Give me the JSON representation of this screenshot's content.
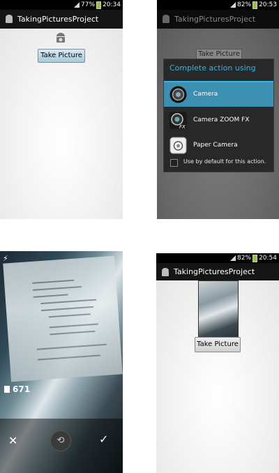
{
  "panel1": {
    "time": "20:34",
    "battery": "77%",
    "app_title": "TakingPicturesProject",
    "button_label": "Take Picture"
  },
  "panel2": {
    "time": "20:53",
    "battery": "82%",
    "app_title": "TakingPicturesProject",
    "button_label": "Take Picture",
    "dialog_title": "Complete action using",
    "options": [
      {
        "label": "Camera",
        "selected": true
      },
      {
        "label": "Camera ZOOM FX",
        "selected": false
      },
      {
        "label": "Paper Camera",
        "selected": false
      }
    ],
    "default_label": "Use by default for this action."
  },
  "panel3": {
    "remaining_count": "671",
    "cancel_glyph": "✕",
    "retake_glyph": "⟲",
    "confirm_glyph": "✓"
  },
  "panel4": {
    "time": "20:54",
    "battery": "82%",
    "app_title": "TakingPicturesProject",
    "button_label": "Take Picture"
  },
  "colors": {
    "accent": "#33b5e5",
    "selected_row": "#3b8fb0",
    "battery_green": "#9bc33a"
  }
}
